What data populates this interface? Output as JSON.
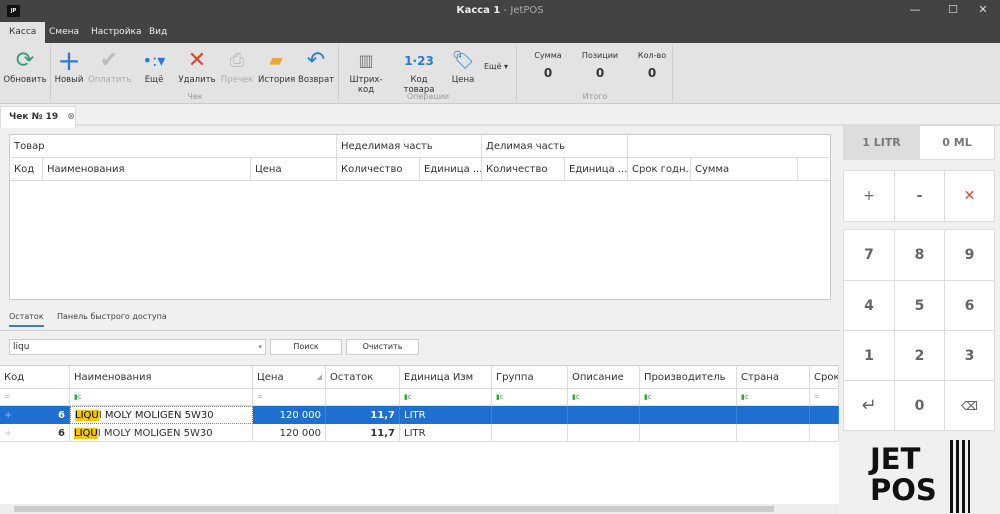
{
  "window": {
    "logo": "JP",
    "title": "Касса 1",
    "title_suffix": " - JetPOS",
    "minimize": "—",
    "maximize": "☐",
    "close": "✕"
  },
  "menu": [
    "Касса",
    "Смена",
    "Настройка",
    "Вид"
  ],
  "ribbon": {
    "refresh": "Обновить",
    "check_buttons": [
      "Новый",
      "Оплатить",
      "Ещё",
      "Удалить",
      "Пречек",
      "История",
      "Возврат"
    ],
    "check_group": "Чек",
    "op_buttons": [
      "Штрих-код",
      "Код товара",
      "Цена"
    ],
    "op_more": "Ещё",
    "op_group": "Операции",
    "totals": [
      {
        "label": "Сумма",
        "value": "0"
      },
      {
        "label": "Позиции",
        "value": "0"
      },
      {
        "label": "Кол-во",
        "value": "0"
      }
    ],
    "totals_group": "Итого",
    "barcode_glyph": "1·23"
  },
  "doc_tab": "Чек № 19",
  "check_grid": {
    "groups": [
      "Товар",
      "Неделимая часть",
      "Делимая часть"
    ],
    "columns": [
      "Код",
      "Наименования",
      "Цена",
      "Количество",
      "Единица ...",
      "Количество",
      "Единица ...",
      "Срок годн...",
      "Сумма"
    ]
  },
  "bottom_tabs": [
    "Остаток",
    "Панель быстрого доступа"
  ],
  "search": {
    "value": "liqu",
    "search_button": "Поиск",
    "clear_button": "Очистить"
  },
  "stock_grid": {
    "columns": [
      "Код",
      "Наименования",
      "Цена",
      "Остаток",
      "Единица Изм",
      "Группа",
      "Описание",
      "Производитель",
      "Страна",
      "Срок"
    ],
    "rows": [
      {
        "code": "6",
        "name_match": "LIQU",
        "name_rest": "I MOLY MOLIGEN 5W30",
        "price": "120 000",
        "stock": "11,7",
        "unit": "LITR",
        "selected": true
      },
      {
        "code": "6",
        "name_match": "LIQU",
        "name_rest": "I MOLY MOLIGEN 5W30",
        "price": "120 000",
        "stock": "11,7",
        "unit": "LITR",
        "selected": false
      }
    ]
  },
  "units": {
    "primary": "1 LITR",
    "secondary": "0 ML"
  },
  "keypad": {
    "ops": [
      "+",
      "-",
      "✕"
    ],
    "digits": [
      "7",
      "8",
      "9",
      "4",
      "5",
      "6",
      "1",
      "2",
      "3"
    ],
    "enter": "↵",
    "zero": "0",
    "erase": "⌫"
  },
  "brand": {
    "line1": "JET",
    "line2": "POS"
  },
  "colors": {
    "accent": "#1e6fd0",
    "highlight": "#f6c600",
    "danger": "#e0452b"
  }
}
